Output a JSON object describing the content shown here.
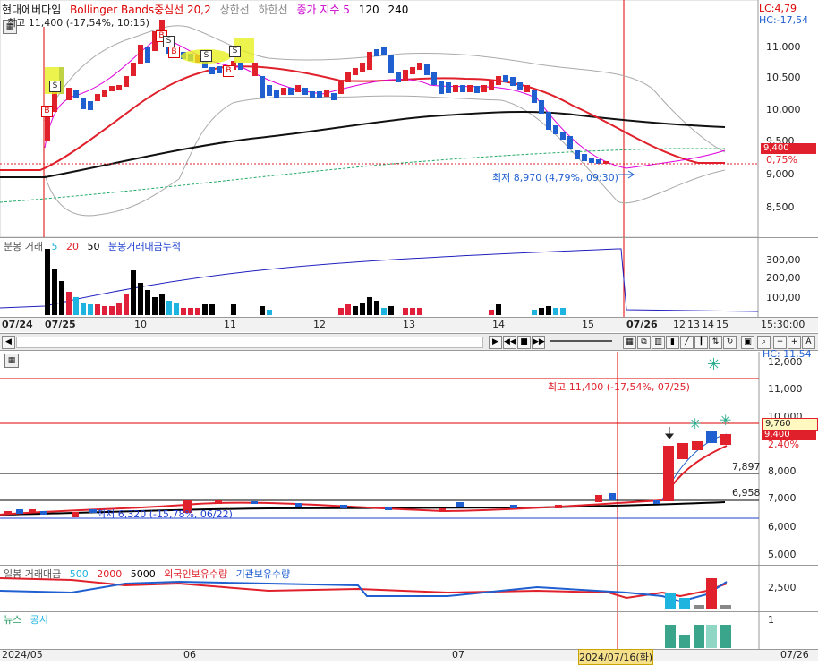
{
  "colors": {
    "up": "#e0202a",
    "down": "#1f5fd0",
    "accent": "#e8f020",
    "volume_up": "#e0203a",
    "volume_down": "#1fb4e0"
  },
  "top_chart": {
    "legend": {
      "stock": "현대에버다임",
      "indicator": "Bollinger Bands중심선 20,2",
      "upper": "상한선",
      "lower": "하한선",
      "ma_title": "종가 지수 5",
      "ma120": "120",
      "ma240": "240"
    },
    "high_label": "최고 11,400 (-17,54%, 10:15)",
    "low_label": "최저 8,970 (4,79%, 09:30)",
    "lc_label": "LC:4,79",
    "hc_label": "HC:-17,54",
    "yaxis": [
      "11,000",
      "10,500",
      "10,000",
      "9,500",
      "9,000",
      "8,500"
    ],
    "current_price": "9,400",
    "current_pct": "0,75%",
    "volume_legend": {
      "title": "분봉 거래",
      "ma5": "5",
      "ma20": "20",
      "ma50": "50",
      "cum": "분봉거래대금누적"
    },
    "volume_yaxis": [
      "300,00",
      "200,00",
      "100,00"
    ],
    "xaxis": [
      "07/24",
      "07/25",
      "10",
      "11",
      "12",
      "13",
      "14",
      "15",
      "07/26",
      "12",
      "13",
      "14",
      "15",
      "15:30:00"
    ],
    "markers": [
      "S",
      "B",
      "B",
      "B",
      "S",
      "S",
      "B",
      "S"
    ]
  },
  "bottom_chart": {
    "high_label": "최고 11,400 (-17,54%, 07/25)",
    "low_label": "최저 6,320 (-15,78%, 06/22)",
    "hc_label": "HC: 11,54",
    "yaxis": [
      "12,000",
      "11,000",
      "10,000",
      "9,000",
      "8,000",
      "7,000",
      "6,000",
      "5,000"
    ],
    "price_tag_1": "9,760",
    "price_tag_2": "9,400",
    "pct_tag": "2,40%",
    "level1": "7,897",
    "level2": "6,958",
    "volume_legend": {
      "title": "일봉 거래대금",
      "v500": "500",
      "v2000": "2000",
      "v5000": "5000",
      "foreign": "외국인보유수량",
      "inst": "기관보유수량"
    },
    "volume_yaxis": [
      "2,500"
    ],
    "news_legend": {
      "news": "뉴스",
      "disclosure": "공시"
    },
    "news_yaxis": [
      "1"
    ],
    "xaxis": [
      "2024/05",
      "06",
      "07",
      "2024/07/16(화)",
      "07/26"
    ]
  },
  "toolbar": {
    "icons": [
      "play-icon",
      "rewind-icon",
      "stop-icon",
      "forward-icon",
      "zoom-out-icon",
      "zoom-in-icon",
      "font-icon"
    ]
  }
}
